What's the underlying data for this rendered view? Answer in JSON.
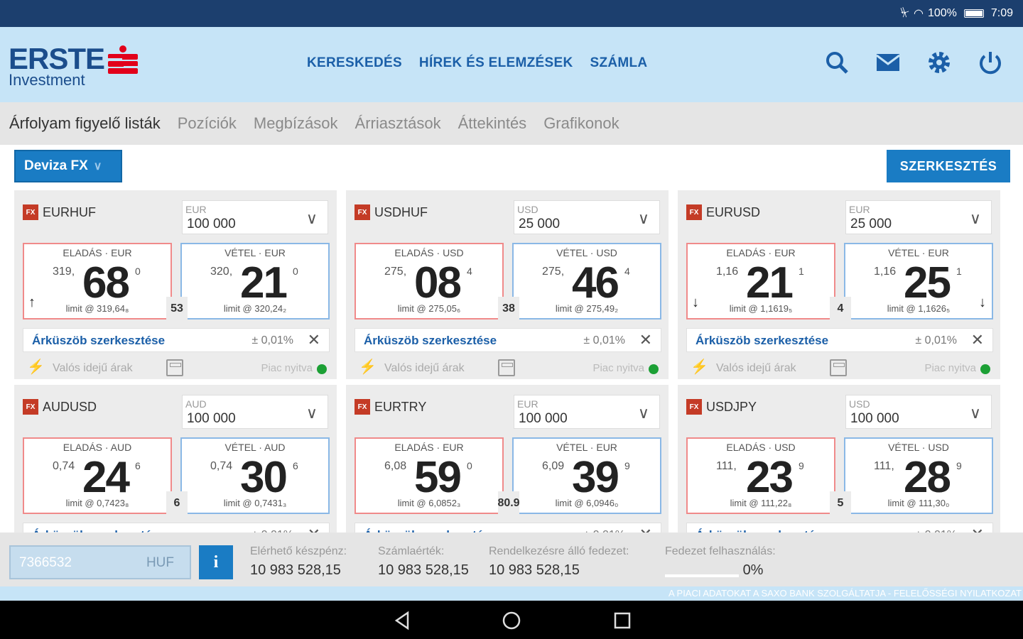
{
  "status": {
    "battery": "100%",
    "time": "7:09"
  },
  "brand": {
    "name": "ERSTE",
    "sub": "Investment",
    "logo_color": "#e2001a"
  },
  "topnav": [
    "KERESKEDÉS",
    "HÍREK ÉS ELEMZÉSEK",
    "SZÁMLA"
  ],
  "icons": [
    "search-icon",
    "mail-icon",
    "gear-icon",
    "power-icon"
  ],
  "tabs": [
    "Árfolyam figyelő listák",
    "Pozíciók",
    "Megbízások",
    "Árriasztások",
    "Áttekintés",
    "Grafikonok"
  ],
  "fx_select": "Deviza FX",
  "edit_button": "SZERKESZTÉS",
  "cards": [
    {
      "symbol": "EURHUF",
      "cur": "EUR",
      "amount": "100 000",
      "sell_label": "ELADÁS · EUR",
      "sell_pre": "319,",
      "sell_big": "68",
      "sell_sup": "0",
      "sell_limit": "limit @ 319,64₈",
      "buy_label": "VÉTEL · EUR",
      "buy_pre": "320,",
      "buy_big": "21",
      "buy_sup": "0",
      "buy_limit": "limit @ 320,24₂",
      "spread": "53",
      "sell_arrow": "↑",
      "buy_arrow": ""
    },
    {
      "symbol": "USDHUF",
      "cur": "USD",
      "amount": "25 000",
      "sell_label": "ELADÁS · USD",
      "sell_pre": "275,",
      "sell_big": "08",
      "sell_sup": "4",
      "sell_limit": "limit @ 275,05₆",
      "buy_label": "VÉTEL · USD",
      "buy_pre": "275,",
      "buy_big": "46",
      "buy_sup": "4",
      "buy_limit": "limit @ 275,49₂",
      "spread": "38",
      "sell_arrow": "",
      "buy_arrow": ""
    },
    {
      "symbol": "EURUSD",
      "cur": "EUR",
      "amount": "25 000",
      "sell_label": "ELADÁS · EUR",
      "sell_pre": "1,16",
      "sell_big": "21",
      "sell_sup": "1",
      "sell_limit": "limit @ 1,1619₅",
      "buy_label": "VÉTEL · EUR",
      "buy_pre": "1,16",
      "buy_big": "25",
      "buy_sup": "1",
      "buy_limit": "limit @ 1,1626₅",
      "spread": "4",
      "sell_arrow": "↓",
      "buy_arrow": "↓"
    },
    {
      "symbol": "AUDUSD",
      "cur": "AUD",
      "amount": "100 000",
      "sell_label": "ELADÁS · AUD",
      "sell_pre": "0,74",
      "sell_big": "24",
      "sell_sup": "6",
      "sell_limit": "limit @ 0,7423₈",
      "buy_label": "VÉTEL · AUD",
      "buy_pre": "0,74",
      "buy_big": "30",
      "buy_sup": "6",
      "buy_limit": "limit @ 0,7431₃",
      "spread": "6",
      "sell_arrow": "",
      "buy_arrow": ""
    },
    {
      "symbol": "EURTRY",
      "cur": "EUR",
      "amount": "100 000",
      "sell_label": "ELADÁS · EUR",
      "sell_pre": "6,08",
      "sell_big": "59",
      "sell_sup": "0",
      "sell_limit": "limit @ 6,0852₃",
      "buy_label": "VÉTEL · EUR",
      "buy_pre": "6,09",
      "buy_big": "39",
      "buy_sup": "9",
      "buy_limit": "limit @ 6,0946₀",
      "spread": "80.9",
      "sell_arrow": "",
      "buy_arrow": ""
    },
    {
      "symbol": "USDJPY",
      "cur": "USD",
      "amount": "100 000",
      "sell_label": "ELADÁS · USD",
      "sell_pre": "111,",
      "sell_big": "23",
      "sell_sup": "9",
      "sell_limit": "limit @ 111,22₈",
      "buy_label": "VÉTEL · USD",
      "buy_pre": "111,",
      "buy_big": "28",
      "buy_sup": "9",
      "buy_limit": "limit @ 111,30₀",
      "spread": "5",
      "sell_arrow": "",
      "buy_arrow": ""
    }
  ],
  "alert": {
    "title": "Árküszöb szerkesztése",
    "pct": "± 0,01%"
  },
  "footer_row": {
    "realtime": "Valós idejű árak",
    "market": "Piac nyitva"
  },
  "account": {
    "number": "7366532",
    "currency": "HUF",
    "info": "i"
  },
  "stats": [
    {
      "label": "Elérhető készpénz:",
      "value": "10 983 528,15"
    },
    {
      "label": "Számlaérték:",
      "value": "10 983 528,15"
    },
    {
      "label": "Rendelkezésre álló fedezet:",
      "value": "10 983 528,15"
    },
    {
      "label": "Fedezet felhasználás:",
      "value": "0%"
    }
  ],
  "disclaimer": "A PIACI ADATOKAT A SAXO BANK SZOLGÁLTATJA - FELELŐSSÉGI NYILATKOZAT"
}
